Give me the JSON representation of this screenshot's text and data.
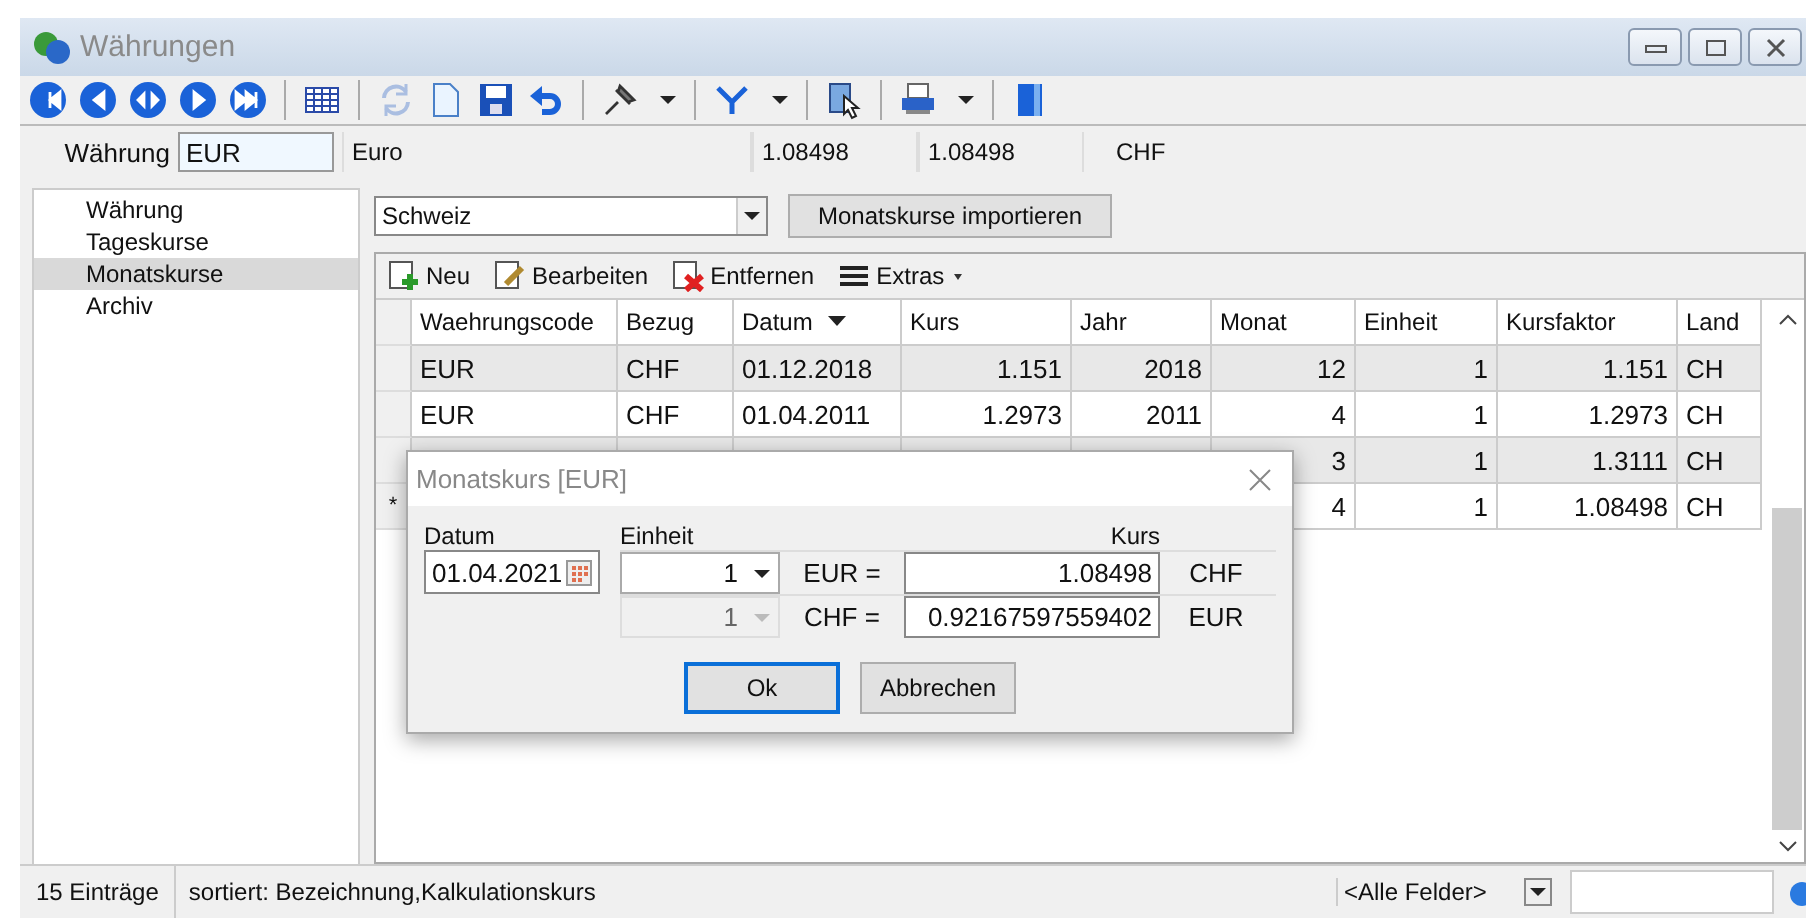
{
  "window": {
    "title": "Währungen"
  },
  "toolbar": [
    [
      {
        "kind": "first",
        "disabled": false
      },
      {
        "kind": "prev",
        "disabled": false
      },
      {
        "kind": "both",
        "disabled": false
      },
      {
        "kind": "next",
        "disabled": false
      },
      {
        "kind": "last",
        "disabled": false
      }
    ],
    [
      {
        "kind": "table",
        "disabled": false
      }
    ],
    [
      {
        "kind": "refresh",
        "disabled": true
      },
      {
        "kind": "new",
        "disabled": false
      },
      {
        "kind": "save",
        "disabled": false
      },
      {
        "kind": "undo",
        "disabled": false
      }
    ],
    [
      {
        "kind": "pin",
        "disabled": false
      },
      {
        "kind": "caret",
        "disabled": false
      }
    ],
    [
      {
        "kind": "filter",
        "disabled": false
      },
      {
        "kind": "caret",
        "disabled": false
      }
    ],
    [
      {
        "kind": "pointer",
        "disabled": false
      }
    ],
    [
      {
        "kind": "print",
        "disabled": false
      },
      {
        "kind": "caret",
        "disabled": false
      }
    ],
    [
      {
        "kind": "book",
        "disabled": false
      }
    ]
  ],
  "header": {
    "label": "Währung",
    "code": "EUR",
    "name": "Euro",
    "rate_1": "1.08498",
    "rate_2": "1.08498",
    "currency": "CHF"
  },
  "sidebar": {
    "items": [
      {
        "label": "Währung",
        "selected": false
      },
      {
        "label": "Tageskurse",
        "selected": false
      },
      {
        "label": "Monatskurse",
        "selected": true
      },
      {
        "label": "Archiv",
        "selected": false
      }
    ]
  },
  "country_select": {
    "value": "Schweiz"
  },
  "import_button": "Monatskurse importieren",
  "grid_toolbar": [
    {
      "kind": "new",
      "label": "Neu"
    },
    {
      "kind": "edit",
      "label": "Bearbeiten"
    },
    {
      "kind": "delete",
      "label": "Entfernen"
    },
    {
      "kind": "menu",
      "label": "Extras"
    }
  ],
  "table": {
    "columns": [
      {
        "label": "Waehrungscode",
        "sorted": false
      },
      {
        "label": "Bezug",
        "sorted": false
      },
      {
        "label": "Datum",
        "sorted": true
      },
      {
        "label": "Kurs",
        "sorted": false
      },
      {
        "label": "Jahr",
        "sorted": false
      },
      {
        "label": "Monat",
        "sorted": false
      },
      {
        "label": "Einheit",
        "sorted": false
      },
      {
        "label": "Kursfaktor",
        "sorted": false
      },
      {
        "label": "Land",
        "sorted": false
      }
    ],
    "rows": [
      {
        "marker": null,
        "cells": [
          "EUR",
          "CHF",
          "01.12.2018",
          "1.151",
          "2018",
          "12",
          "1",
          "1.151",
          "CH"
        ]
      },
      {
        "marker": null,
        "cells": [
          "EUR",
          "CHF",
          "01.04.2011",
          "1.2973",
          "2011",
          "4",
          "1",
          "1.2973",
          "CH"
        ]
      },
      {
        "marker": null,
        "cells": [
          "3",
          "1",
          "1.3111",
          "CH"
        ]
      },
      {
        "marker": "*",
        "cells": [
          "4",
          "1",
          "1.08498",
          "CH"
        ]
      }
    ]
  },
  "dialog": {
    "title": "Monatskurs [EUR]",
    "date_label": "Datum",
    "date": "01.04.2021",
    "unit_label": "Einheit",
    "rate_label": "Kurs",
    "lines": [
      {
        "unit": "1",
        "disabled": false,
        "from": "EUR =",
        "rate": "1.08498",
        "to": "CHF"
      },
      {
        "unit": "1",
        "disabled": true,
        "from": "CHF =",
        "rate": "0.92167597559402",
        "to": "EUR"
      }
    ],
    "buttons": [
      {
        "label": "Ok",
        "default": true
      },
      {
        "label": "Abbrechen",
        "default": false
      }
    ]
  },
  "status_bar": {
    "count": "15 Einträge",
    "sort": "sortiert: Bezeichnung,Kalkulationskurs",
    "field_filter": "<Alle Felder>"
  }
}
